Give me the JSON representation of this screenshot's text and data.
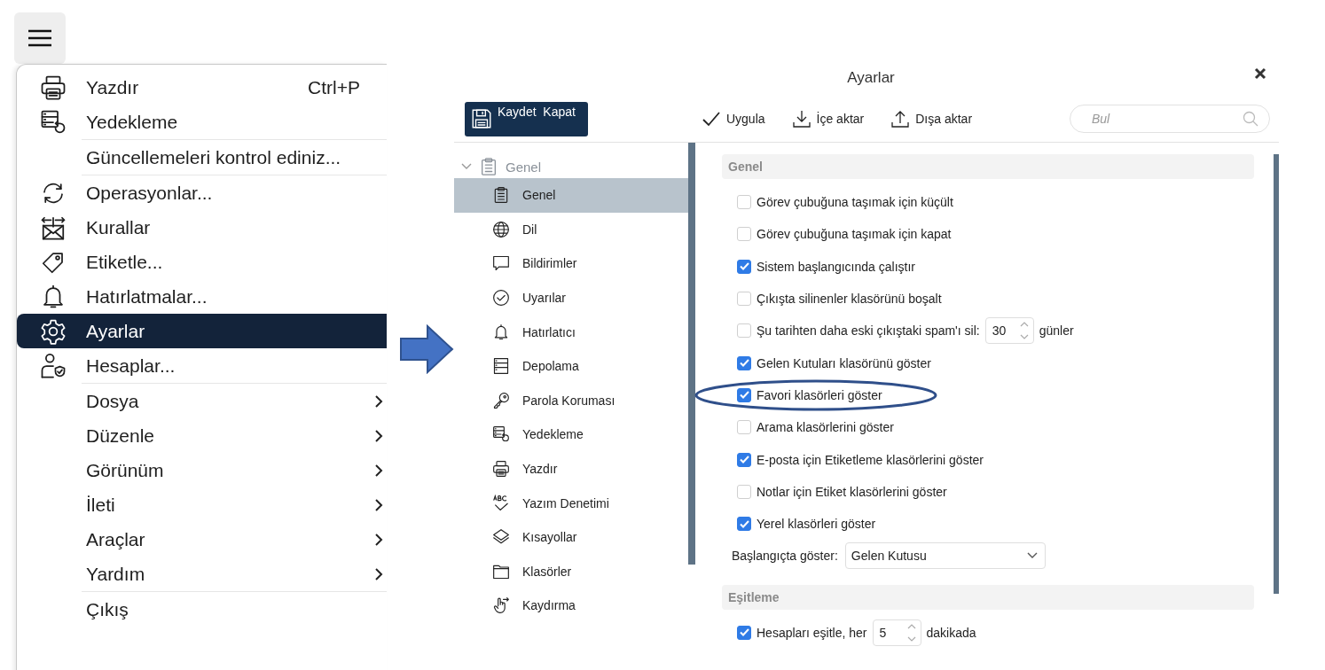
{
  "menu": {
    "groups": [
      {
        "items": [
          {
            "label": "Yazdır",
            "shortcut": "Ctrl+P",
            "selected": false,
            "submenu": false
          },
          {
            "label": "Yedekleme",
            "selected": false,
            "submenu": false
          }
        ]
      },
      {
        "items": [
          {
            "label": "Güncellemeleri kontrol ediniz...",
            "selected": false,
            "submenu": false
          }
        ]
      },
      {
        "items": [
          {
            "label": "Operasyonlar...",
            "selected": false,
            "submenu": false
          },
          {
            "label": "Kurallar",
            "selected": false,
            "submenu": false
          },
          {
            "label": "Etiketle...",
            "selected": false,
            "submenu": false
          },
          {
            "label": "Hatırlatmalar...",
            "selected": false,
            "submenu": false
          },
          {
            "label": "Ayarlar",
            "selected": true,
            "submenu": false
          },
          {
            "label": "Hesaplar...",
            "selected": false,
            "submenu": false
          }
        ]
      },
      {
        "items": [
          {
            "label": "Dosya",
            "selected": false,
            "submenu": true
          },
          {
            "label": "Düzenle",
            "selected": false,
            "submenu": true
          },
          {
            "label": "Görünüm",
            "selected": false,
            "submenu": true
          },
          {
            "label": "İleti",
            "selected": false,
            "submenu": true
          },
          {
            "label": "Araçlar",
            "selected": false,
            "submenu": true
          },
          {
            "label": "Yardım",
            "selected": false,
            "submenu": true
          }
        ]
      },
      {
        "items": [
          {
            "label": "Çıkış",
            "selected": false,
            "submenu": false
          }
        ]
      }
    ]
  },
  "dialog": {
    "title": "Ayarlar",
    "toolbar": {
      "primary_button": "Kaydet  Kapat",
      "actions": [
        "Uygula",
        "İçe aktar",
        "Dışa aktar"
      ],
      "search": {
        "placeholder": "Bul"
      }
    },
    "sidebar": {
      "tree": [
        {
          "label": "Genel",
          "expanded": true,
          "selected": false,
          "children": [
            {
              "label": "Genel",
              "selected": true
            },
            {
              "label": "Dil",
              "selected": false
            },
            {
              "label": "Bildirimler",
              "selected": false
            },
            {
              "label": "Uyarılar",
              "selected": false
            },
            {
              "label": "Hatırlatıcı",
              "selected": false
            },
            {
              "label": "Depolama",
              "selected": false
            },
            {
              "label": "Parola Koruması",
              "selected": false
            },
            {
              "label": "Yedekleme",
              "selected": false
            },
            {
              "label": "Yazdır",
              "selected": false
            },
            {
              "label": "Yazım Denetimi",
              "selected": false
            },
            {
              "label": "Kısayollar",
              "selected": false
            },
            {
              "label": "Klasörler",
              "selected": false
            },
            {
              "label": "Kaydırma",
              "selected": false
            }
          ]
        }
      ]
    },
    "content": {
      "sections": [
        {
          "title": "Genel",
          "options": [
            {
              "kind": "checkbox",
              "label": "Görev çubuğuna taşımak için küçült",
              "checked": false,
              "highlighted": false
            },
            {
              "kind": "checkbox",
              "label": "Görev çubuğuna taşımak için kapat",
              "checked": false,
              "highlighted": false
            },
            {
              "kind": "checkbox",
              "label": "Sistem başlangıcında çalıştır",
              "checked": true,
              "highlighted": false
            },
            {
              "kind": "checkbox",
              "label": "Çıkışta silinenler klasörünü boşalt",
              "checked": false,
              "highlighted": false
            },
            {
              "kind": "checkbox_number",
              "label": "Şu tarihten daha eski çıkıştaki spam'ı sil:",
              "checked": false,
              "value": "30",
              "suffix": "günler",
              "highlighted": false
            },
            {
              "kind": "checkbox",
              "label": "Gelen Kutuları klasörünü göster",
              "checked": true,
              "highlighted": false
            },
            {
              "kind": "checkbox",
              "label": "Favori klasörleri göster",
              "checked": true,
              "highlighted": true
            },
            {
              "kind": "checkbox",
              "label": "Arama klasörlerini göster",
              "checked": false,
              "highlighted": false
            },
            {
              "kind": "checkbox",
              "label": "E-posta için Etiketleme klasörlerini göster",
              "checked": true,
              "highlighted": false
            },
            {
              "kind": "checkbox",
              "label": "Notlar için Etiket klasörlerini göster",
              "checked": false,
              "highlighted": false
            },
            {
              "kind": "checkbox",
              "label": "Yerel klasörleri göster",
              "checked": true,
              "highlighted": false
            },
            {
              "kind": "select",
              "label": "Başlangıçta göster:",
              "value": "Gelen Kutusu",
              "highlighted": false
            }
          ]
        },
        {
          "title": "Eşitleme",
          "options": [
            {
              "kind": "checkbox_number",
              "label": "Hesapları eşitle, her",
              "checked": true,
              "value": "5",
              "suffix": "dakikada",
              "highlighted": false
            }
          ]
        }
      ]
    }
  }
}
